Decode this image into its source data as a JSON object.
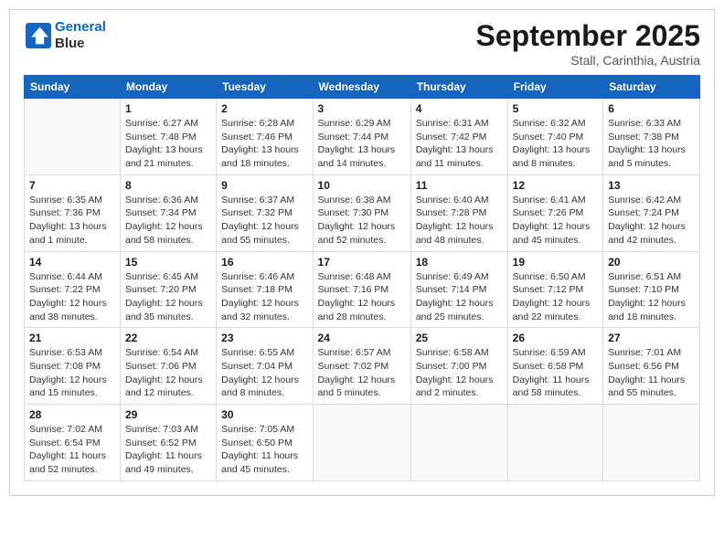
{
  "header": {
    "logo_line1": "General",
    "logo_line2": "Blue",
    "month": "September 2025",
    "location": "Stall, Carinthia, Austria"
  },
  "weekdays": [
    "Sunday",
    "Monday",
    "Tuesday",
    "Wednesday",
    "Thursday",
    "Friday",
    "Saturday"
  ],
  "weeks": [
    [
      {
        "day": "",
        "info": ""
      },
      {
        "day": "1",
        "info": "Sunrise: 6:27 AM\nSunset: 7:48 PM\nDaylight: 13 hours\nand 21 minutes."
      },
      {
        "day": "2",
        "info": "Sunrise: 6:28 AM\nSunset: 7:46 PM\nDaylight: 13 hours\nand 18 minutes."
      },
      {
        "day": "3",
        "info": "Sunrise: 6:29 AM\nSunset: 7:44 PM\nDaylight: 13 hours\nand 14 minutes."
      },
      {
        "day": "4",
        "info": "Sunrise: 6:31 AM\nSunset: 7:42 PM\nDaylight: 13 hours\nand 11 minutes."
      },
      {
        "day": "5",
        "info": "Sunrise: 6:32 AM\nSunset: 7:40 PM\nDaylight: 13 hours\nand 8 minutes."
      },
      {
        "day": "6",
        "info": "Sunrise: 6:33 AM\nSunset: 7:38 PM\nDaylight: 13 hours\nand 5 minutes."
      }
    ],
    [
      {
        "day": "7",
        "info": "Sunrise: 6:35 AM\nSunset: 7:36 PM\nDaylight: 13 hours\nand 1 minute."
      },
      {
        "day": "8",
        "info": "Sunrise: 6:36 AM\nSunset: 7:34 PM\nDaylight: 12 hours\nand 58 minutes."
      },
      {
        "day": "9",
        "info": "Sunrise: 6:37 AM\nSunset: 7:32 PM\nDaylight: 12 hours\nand 55 minutes."
      },
      {
        "day": "10",
        "info": "Sunrise: 6:38 AM\nSunset: 7:30 PM\nDaylight: 12 hours\nand 52 minutes."
      },
      {
        "day": "11",
        "info": "Sunrise: 6:40 AM\nSunset: 7:28 PM\nDaylight: 12 hours\nand 48 minutes."
      },
      {
        "day": "12",
        "info": "Sunrise: 6:41 AM\nSunset: 7:26 PM\nDaylight: 12 hours\nand 45 minutes."
      },
      {
        "day": "13",
        "info": "Sunrise: 6:42 AM\nSunset: 7:24 PM\nDaylight: 12 hours\nand 42 minutes."
      }
    ],
    [
      {
        "day": "14",
        "info": "Sunrise: 6:44 AM\nSunset: 7:22 PM\nDaylight: 12 hours\nand 38 minutes."
      },
      {
        "day": "15",
        "info": "Sunrise: 6:45 AM\nSunset: 7:20 PM\nDaylight: 12 hours\nand 35 minutes."
      },
      {
        "day": "16",
        "info": "Sunrise: 6:46 AM\nSunset: 7:18 PM\nDaylight: 12 hours\nand 32 minutes."
      },
      {
        "day": "17",
        "info": "Sunrise: 6:48 AM\nSunset: 7:16 PM\nDaylight: 12 hours\nand 28 minutes."
      },
      {
        "day": "18",
        "info": "Sunrise: 6:49 AM\nSunset: 7:14 PM\nDaylight: 12 hours\nand 25 minutes."
      },
      {
        "day": "19",
        "info": "Sunrise: 6:50 AM\nSunset: 7:12 PM\nDaylight: 12 hours\nand 22 minutes."
      },
      {
        "day": "20",
        "info": "Sunrise: 6:51 AM\nSunset: 7:10 PM\nDaylight: 12 hours\nand 18 minutes."
      }
    ],
    [
      {
        "day": "21",
        "info": "Sunrise: 6:53 AM\nSunset: 7:08 PM\nDaylight: 12 hours\nand 15 minutes."
      },
      {
        "day": "22",
        "info": "Sunrise: 6:54 AM\nSunset: 7:06 PM\nDaylight: 12 hours\nand 12 minutes."
      },
      {
        "day": "23",
        "info": "Sunrise: 6:55 AM\nSunset: 7:04 PM\nDaylight: 12 hours\nand 8 minutes."
      },
      {
        "day": "24",
        "info": "Sunrise: 6:57 AM\nSunset: 7:02 PM\nDaylight: 12 hours\nand 5 minutes."
      },
      {
        "day": "25",
        "info": "Sunrise: 6:58 AM\nSunset: 7:00 PM\nDaylight: 12 hours\nand 2 minutes."
      },
      {
        "day": "26",
        "info": "Sunrise: 6:59 AM\nSunset: 6:58 PM\nDaylight: 11 hours\nand 58 minutes."
      },
      {
        "day": "27",
        "info": "Sunrise: 7:01 AM\nSunset: 6:56 PM\nDaylight: 11 hours\nand 55 minutes."
      }
    ],
    [
      {
        "day": "28",
        "info": "Sunrise: 7:02 AM\nSunset: 6:54 PM\nDaylight: 11 hours\nand 52 minutes."
      },
      {
        "day": "29",
        "info": "Sunrise: 7:03 AM\nSunset: 6:52 PM\nDaylight: 11 hours\nand 49 minutes."
      },
      {
        "day": "30",
        "info": "Sunrise: 7:05 AM\nSunset: 6:50 PM\nDaylight: 11 hours\nand 45 minutes."
      },
      {
        "day": "",
        "info": ""
      },
      {
        "day": "",
        "info": ""
      },
      {
        "day": "",
        "info": ""
      },
      {
        "day": "",
        "info": ""
      }
    ]
  ]
}
